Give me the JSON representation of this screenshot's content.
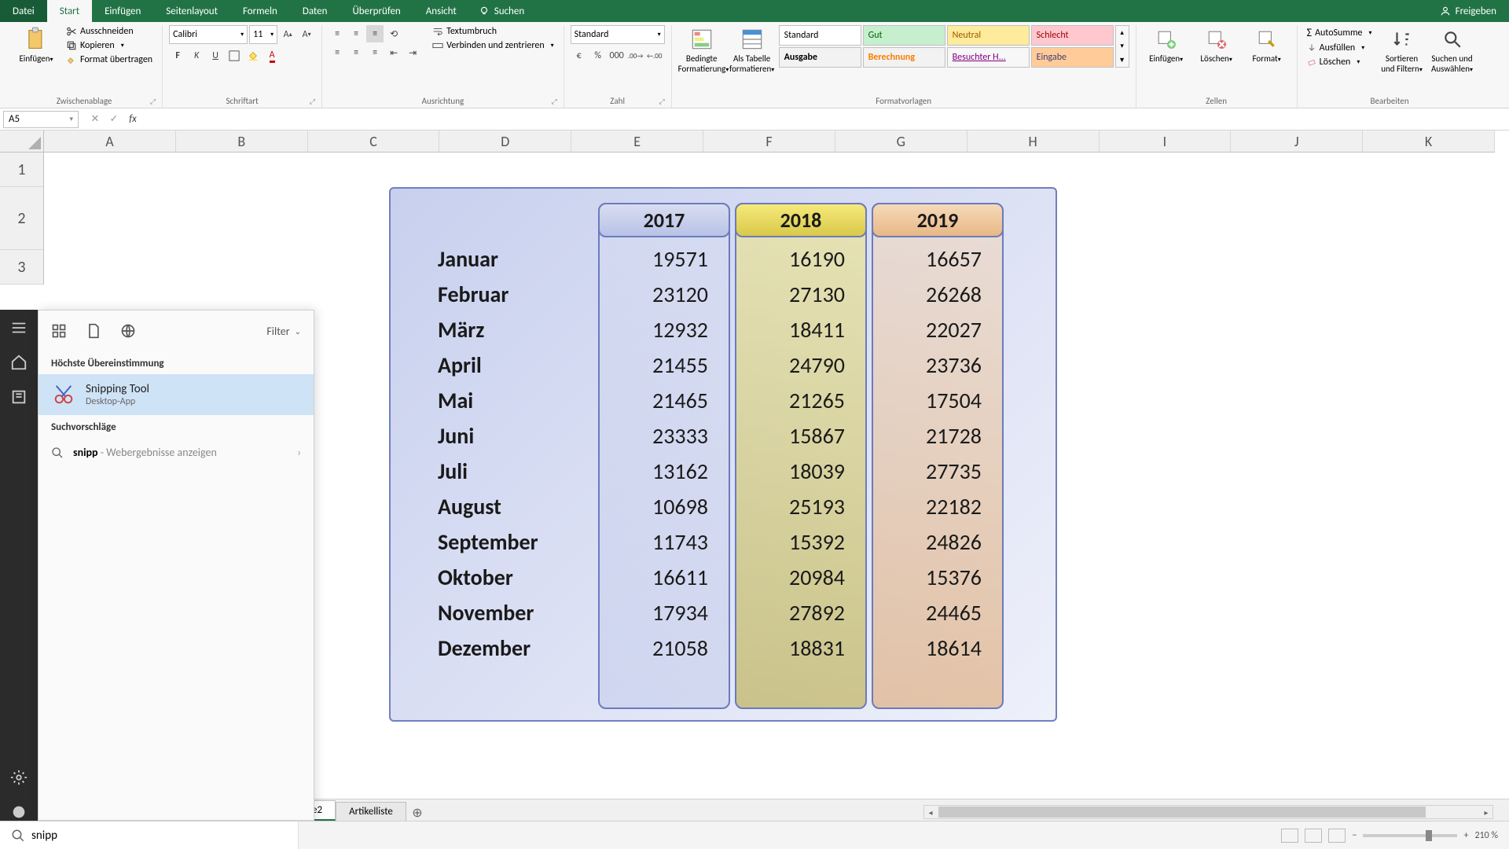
{
  "titlebar": {
    "tabs": [
      "Datei",
      "Start",
      "Einfügen",
      "Seitenlayout",
      "Formeln",
      "Daten",
      "Überprüfen",
      "Ansicht"
    ],
    "active_tab": "Start",
    "search_label": "Suchen",
    "share_label": "Freigeben"
  },
  "ribbon": {
    "clipboard": {
      "paste": "Einfügen",
      "cut": "Ausschneiden",
      "copy": "Kopieren",
      "format_painter": "Format übertragen",
      "group_label": "Zwischenablage"
    },
    "font": {
      "name": "Calibri",
      "size": "11",
      "group_label": "Schriftart"
    },
    "alignment": {
      "wrap": "Textumbruch",
      "merge": "Verbinden und zentrieren",
      "group_label": "Ausrichtung"
    },
    "number": {
      "format": "Standard",
      "group_label": "Zahl"
    },
    "styles": {
      "cond": "Bedingte Formatierung",
      "table": "Als Tabelle formatieren",
      "cells": [
        "Standard",
        "Gut",
        "Neutral",
        "Schlecht",
        "Ausgabe",
        "Berechnung",
        "Besuchter H...",
        "Eingabe"
      ],
      "group_label": "Formatvorlagen"
    },
    "cells_group": {
      "insert": "Einfügen",
      "delete": "Löschen",
      "format": "Format",
      "group_label": "Zellen"
    },
    "editing": {
      "autosum": "AutoSumme",
      "fill": "Ausfüllen",
      "clear": "Löschen",
      "sort": "Sortieren und Filtern",
      "find": "Suchen und Auswählen",
      "group_label": "Bearbeiten"
    }
  },
  "formula_bar": {
    "name_box": "A5",
    "formula": ""
  },
  "columns": [
    "A",
    "B",
    "C",
    "D",
    "E",
    "F",
    "G",
    "H",
    "I",
    "J",
    "K"
  ],
  "rows": [
    "1",
    "2",
    "3"
  ],
  "table": {
    "years": [
      "2017",
      "2018",
      "2019"
    ],
    "months": [
      "Januar",
      "Februar",
      "März",
      "April",
      "Mai",
      "Juni",
      "Juli",
      "August",
      "September",
      "Oktober",
      "November",
      "Dezember"
    ],
    "data": {
      "2017": [
        19571,
        23120,
        12932,
        21455,
        21465,
        23333,
        13162,
        10698,
        11743,
        16611,
        17934,
        21058
      ],
      "2018": [
        16190,
        27130,
        18411,
        24790,
        21265,
        15867,
        18039,
        25193,
        15392,
        20984,
        27892,
        18831
      ],
      "2019": [
        16657,
        26268,
        22027,
        23736,
        17504,
        21728,
        27735,
        22182,
        24826,
        15376,
        24465,
        18614
      ]
    }
  },
  "search_panel": {
    "filter": "Filter",
    "best_match_header": "Höchste Übereinstimmung",
    "result_title": "Snipping Tool",
    "result_sub": "Desktop-App",
    "suggestions_header": "Suchvorschläge",
    "suggest_term": "snipp",
    "suggest_tail": " - Webergebnisse anzeigen"
  },
  "sheets": {
    "active": "e2",
    "other": "Artikelliste"
  },
  "status": {
    "zoom": "210 %"
  },
  "taskbar": {
    "search_value": "snipp"
  }
}
